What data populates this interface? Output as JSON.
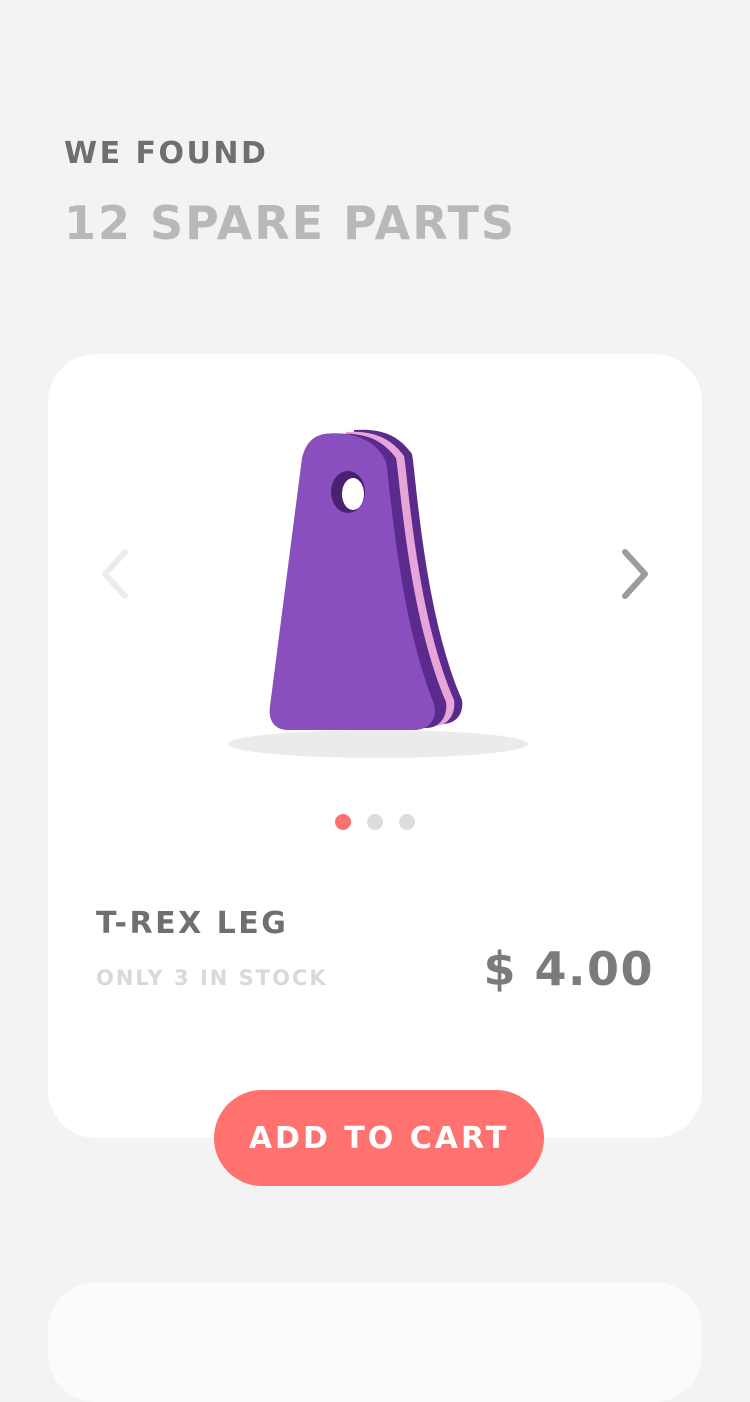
{
  "header": {
    "eyebrow": "WE FOUND",
    "headline": "12 SPARE PARTS"
  },
  "product": {
    "name": "T-REX LEG",
    "stock": "ONLY 3 IN STOCK",
    "price": "$ 4.00",
    "image_icon": "foam-part-image",
    "image_colors": {
      "main": "#8a4fbf",
      "dark_layer": "#5a2a8c",
      "pink_layer": "#e7a6d9"
    }
  },
  "carousel": {
    "prev_icon": "chevron-left-icon",
    "next_icon": "chevron-right-icon",
    "page_count": 3,
    "active_index": 0
  },
  "cart": {
    "button_label": "ADD TO CART"
  },
  "colors": {
    "accent": "#ff7270",
    "background": "#f4f3f4",
    "card": "#ffffff"
  }
}
